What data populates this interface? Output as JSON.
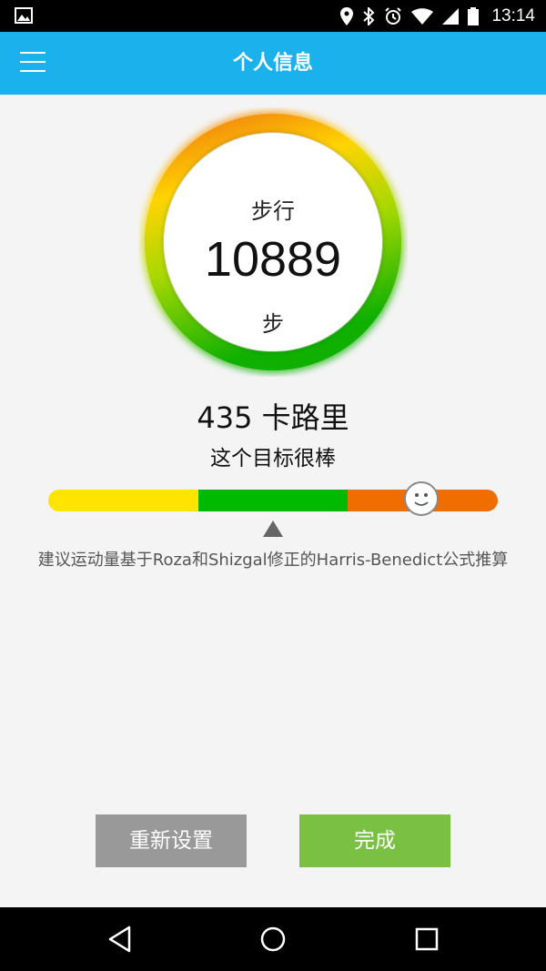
{
  "status_bar": {
    "time": "13:14",
    "icons": [
      "image-icon",
      "location-icon",
      "bluetooth-icon",
      "alarm-icon",
      "wifi-icon",
      "signal-icon",
      "battery-icon"
    ]
  },
  "app_bar": {
    "title": "个人信息",
    "menu_icon": "hamburger-menu-icon"
  },
  "steps": {
    "label": "步行",
    "value": "10889",
    "unit": "步"
  },
  "calories": {
    "text": "435 卡路里"
  },
  "goal": {
    "text": "这个目标很棒"
  },
  "level": {
    "position": 0.83,
    "colors": [
      "#ffe400",
      "#00b900",
      "#f06d00"
    ]
  },
  "formula_note": "建议运动量基于Roza和Shizgal修正的Harris-Benedict公式推算",
  "buttons": {
    "reset": "重新设置",
    "done": "完成"
  },
  "colors": {
    "app_bar": "#1ab1ec",
    "done_button": "#7ac043",
    "reset_button": "#999999"
  }
}
